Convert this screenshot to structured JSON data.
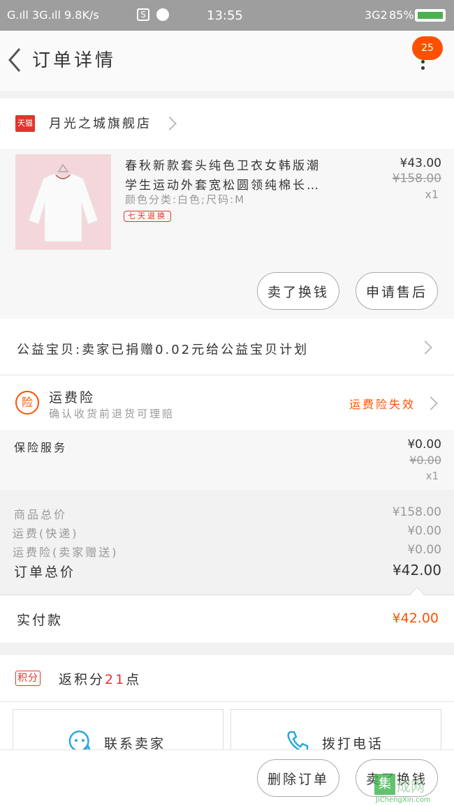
{
  "status_bar": {
    "left": "G.ıll 3G.ıll 9.8K/s",
    "time": "13:55",
    "network": "3G2",
    "battery": "85%"
  },
  "header": {
    "title": "订单详情",
    "badge": "25"
  },
  "store": {
    "tmall_label": "天猫",
    "name": "月光之城旗舰店"
  },
  "product": {
    "title_line1": "春秋新款套头纯色卫衣女韩版潮",
    "title_line2": "学生运动外套宽松圆领纯棉长…",
    "sku": "颜色分类:白色;尺码:M",
    "tag": "七天退换",
    "price": "¥43.00",
    "original_price": "¥158.00",
    "qty": "x1",
    "btn_exchange": "卖了换钱",
    "btn_aftersale": "申请售后"
  },
  "charity": {
    "text": "公益宝贝:卖家已捐赠0.02元给公益宝贝计划"
  },
  "insurance": {
    "icon_text": "险",
    "title": "运费险",
    "subtitle": "确认收货前退货可理赔",
    "status": "运费险失效"
  },
  "insurance_service": {
    "label": "保险服务",
    "price": "¥0.00",
    "original_price": "¥0.00",
    "qty": "x1"
  },
  "summary": {
    "goods_label": "商品总价",
    "goods_value": "¥158.00",
    "shipping_label": "运费(快递)",
    "shipping_value": "¥0.00",
    "ins_label": "运费险(卖家赠送)",
    "ins_value": "¥0.00",
    "total_label": "订单总价",
    "total_value": "¥42.00",
    "paid_label": "实付款",
    "paid_value": "¥42.00"
  },
  "points": {
    "badge": "积分",
    "text_prefix": "返积分",
    "number": "21",
    "text_suffix": "点"
  },
  "contact": {
    "seller": "联系卖家",
    "phone": "拨打电话"
  },
  "bottom": {
    "delete": "删除订单",
    "sell": "卖了换钱"
  },
  "watermark": {
    "text": "JiChengXin.com"
  },
  "colors": {
    "orange": "#ff5000",
    "tmall_red": "#e4342b",
    "contact_blue": "#2ba7e0"
  }
}
